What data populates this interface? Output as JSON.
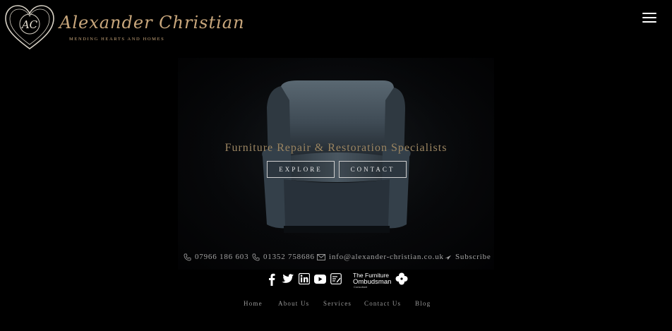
{
  "brand": {
    "monogram": "AC",
    "name": "Alexander Christian",
    "tagline": "MENDING HEARTS AND HOMES",
    "accent_color": "#c9a77c"
  },
  "header": {
    "menu_icon": "hamburger-icon"
  },
  "hero": {
    "headline": "Furniture Repair & Restoration Specialists",
    "buttons": {
      "explore": "EXPLORE",
      "contact": "CONTACT"
    }
  },
  "contact": {
    "phone1": "07966 186 603",
    "phone2": "01352 758686",
    "email": "info@alexander-christian.co.uk",
    "subscribe": "Subscribe"
  },
  "social": [
    "facebook-icon",
    "twitter-icon",
    "linkedin-icon",
    "youtube-icon",
    "blog-icon"
  ],
  "ombudsman": {
    "line1": "The Furniture",
    "line2": "Ombudsman",
    "line3": "Consultant"
  },
  "footer_nav": [
    "Home",
    "About Us",
    "Services",
    "Contact Us",
    "Blog"
  ]
}
